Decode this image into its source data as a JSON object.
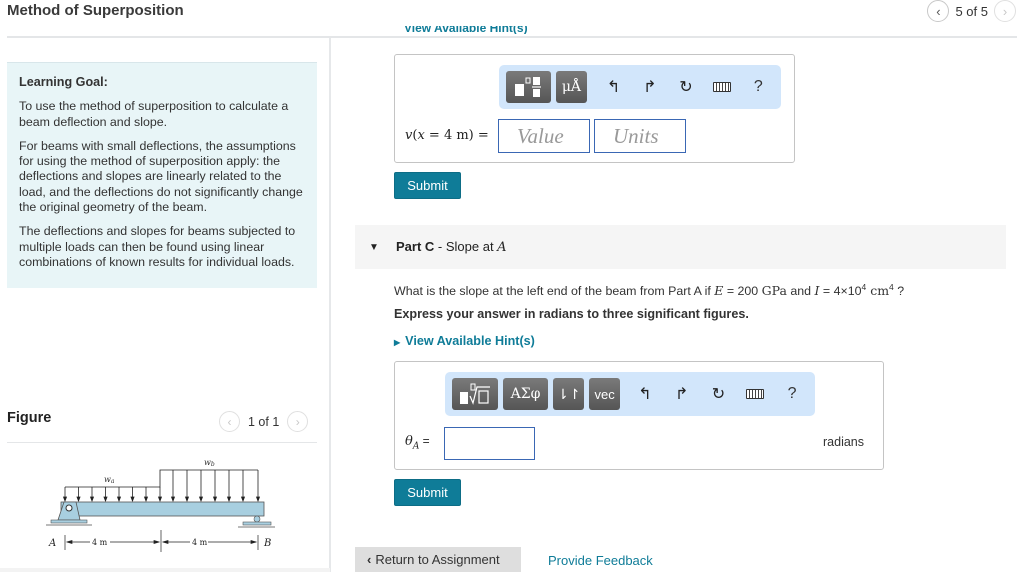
{
  "header": {
    "title": "Method of Superposition",
    "pager": {
      "text": "5 of 5",
      "prev_icon": "chevron-left-icon",
      "next_icon": "chevron-right-icon"
    }
  },
  "learning_goal": {
    "heading": "Learning Goal:",
    "paragraphs": [
      "To use the method of superposition to calculate a beam deflection and slope.",
      "For beams with small deflections, the assumptions for using the method of superposition apply: the deflections and slopes are linearly related to the load, and the deflections do not significantly change the original geometry of the beam.",
      "The deflections and slopes for beams subjected to multiple loads can then be found using linear combinations of known results for individual loads."
    ]
  },
  "figure": {
    "heading": "Figure",
    "pager_text": "1 of 1",
    "labels": {
      "wa": "w",
      "wa_sub": "a",
      "wb": "w",
      "wb_sub": "b",
      "left_support": "A",
      "right_support": "B",
      "span1": "4 m",
      "span2": "4 m"
    }
  },
  "part_b": {
    "hint_link_cut": "View Available Hint(s)",
    "toolbar": [
      "templates-icon",
      "units-icon",
      "undo-icon",
      "redo-icon",
      "reset-icon",
      "keyboard-icon",
      "help-icon"
    ],
    "units_btn": "μÅ",
    "help": "?",
    "equation_label": "v(x = 4 m) =",
    "value_placeholder": "Value",
    "units_placeholder": "Units",
    "submit_label": "Submit"
  },
  "part_c": {
    "label_bold": "Part C",
    "label_rest": " - Slope at ",
    "label_var": "A",
    "question_pre": "What is the slope at the left end of the beam from Part A if ",
    "E_sym": "E",
    "E_val": " = 200 ",
    "E_unit": "GPa",
    "and": " and ",
    "I_sym": "I",
    "I_val": " = 4×10",
    "I_exp": "4",
    "I_unit": " cm",
    "I_unit_exp": "4",
    "question_post": " ?",
    "instruction": "Express your answer in radians to three significant figures.",
    "hint_link": "View Available Hint(s)",
    "toolbar": [
      "templates-icon",
      "greek-icon",
      "arrows-icon",
      "vec-icon",
      "undo-icon",
      "redo-icon",
      "reset-icon",
      "keyboard-icon",
      "help-icon"
    ],
    "greek_btn": "ΑΣφ",
    "arrows_btn": "⇂↾",
    "vec_btn": "vec",
    "help": "?",
    "equation_label_sym": "θ",
    "equation_label_sub": "A",
    "equation_label_eq": " =",
    "answer_value": "",
    "unit_label": "radians",
    "submit_label": "Submit"
  },
  "footer": {
    "return_label": "Return to Assignment",
    "feedback_label": "Provide Feedback"
  },
  "colors": {
    "accent": "#0f7c98",
    "goal_bg": "#e8f5f7",
    "toolbar_bg": "#d2e6fb",
    "beam": "#a8cfe0"
  }
}
